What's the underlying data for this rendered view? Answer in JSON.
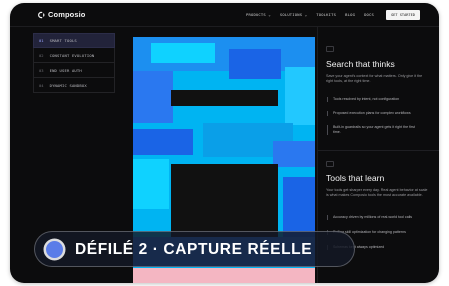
{
  "brand": {
    "name": "Composio"
  },
  "nav": {
    "links": [
      "PRODUCTS ⌄",
      "SOLUTIONS ⌄",
      "TOOLKITS",
      "BLOG",
      "DOCS"
    ],
    "cta_label": "GET STARTED"
  },
  "menu": {
    "items": [
      {
        "num": "01",
        "label": "SMART TOOLS",
        "active": true
      },
      {
        "num": "02",
        "label": "CONSTANT EVOLUTION",
        "active": false
      },
      {
        "num": "03",
        "label": "END USER AUTH",
        "active": false
      },
      {
        "num": "04",
        "label": "DYNAMIC SANDBOX",
        "active": false
      }
    ]
  },
  "section1": {
    "title": "Search that thinks",
    "description": "Save your agent's context for what matters. Only give it the right tools, at the right time.",
    "features": [
      "Tools resolved by intent, not configuration",
      "Proposed execution plans for complex workflows",
      "Built-in guardrails so your agent gets it right the first time."
    ]
  },
  "section2": {
    "title": "Tools that learn",
    "description": "Your tools get sharper every day. Real agent behavior at scale is what makes Composio tools the most accurate available.",
    "features": [
      "Accuracy driven by millions of real-world tool calls",
      "Rolling skill optimization for changing patterns",
      "Schemas kept always optimized"
    ]
  },
  "overlay": {
    "label": "DÉFILÉ 2 · CAPTURE RÉELLE"
  },
  "colors": {
    "background": "#0c0c0d",
    "visual_cyan": "#00b4f2",
    "visual_blue": "#1a64e6",
    "visual_pink": "#f4b6c2",
    "accent": "#5a7ce8"
  },
  "icons": [
    "composio-logo-icon",
    "chevron-down-icon",
    "section-icon"
  ]
}
